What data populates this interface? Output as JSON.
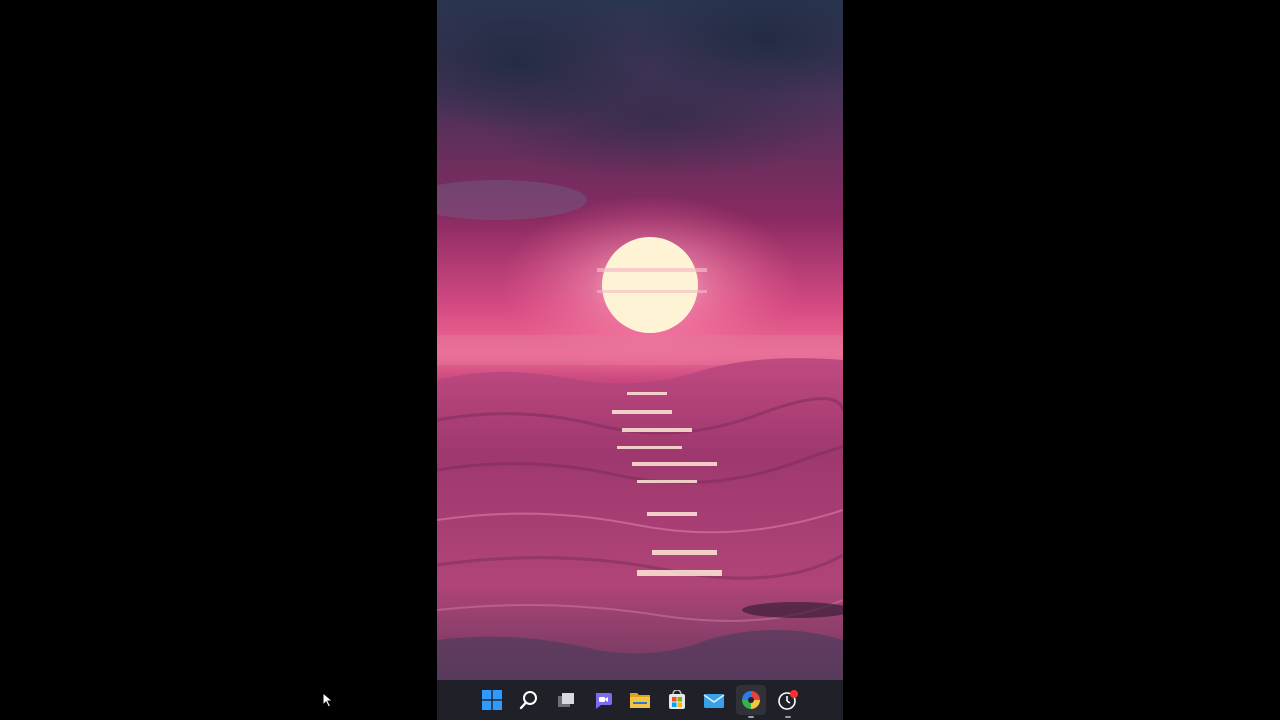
{
  "screen": {
    "wallpaper": "sunset-over-ocean",
    "colors": {
      "sky_top": "#2a3550",
      "sky_mid": "#8a2a62",
      "horizon": "#ef5d8e",
      "sun": "#fff3d6",
      "sea": "#b03a73",
      "sea_dark": "#5a2a4e",
      "taskbar": "#202028"
    }
  },
  "taskbar": {
    "items": [
      {
        "name": "start-button",
        "icon": "windows-logo-icon",
        "color": "#2f9bff"
      },
      {
        "name": "search-button",
        "icon": "search-icon",
        "color": "#ffffff"
      },
      {
        "name": "task-view-button",
        "icon": "task-view-icon",
        "color": "#d0d0d0"
      },
      {
        "name": "chat-button",
        "icon": "teams-chat-icon",
        "color": "#7b6cf0"
      },
      {
        "name": "file-explorer-button",
        "icon": "folder-icon",
        "color": "#f4c542"
      },
      {
        "name": "store-button",
        "icon": "store-icon",
        "color": "#e8e8e8"
      },
      {
        "name": "mail-button",
        "icon": "mail-icon",
        "color": "#3aa0e8"
      },
      {
        "name": "color-app-button",
        "icon": "color-wheel-icon",
        "color": "#e84040"
      },
      {
        "name": "clock-app-button",
        "icon": "clock-icon",
        "color": "#ffffff"
      }
    ],
    "notification_badge_color": "#ff3030"
  }
}
